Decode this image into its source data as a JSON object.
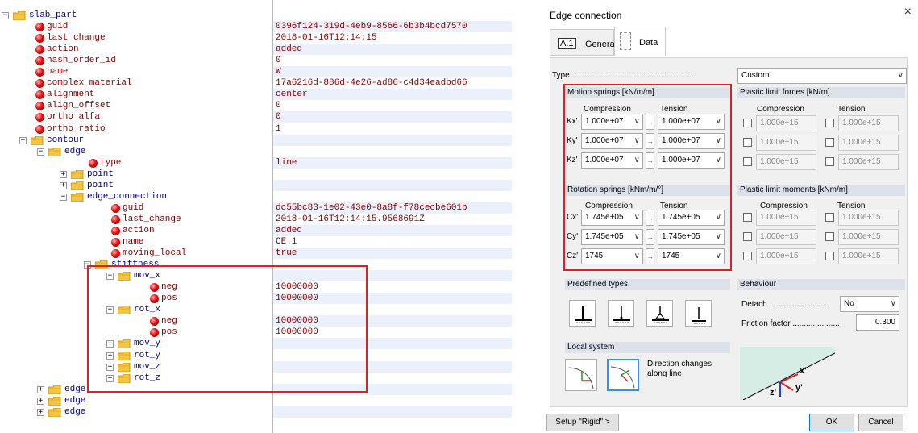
{
  "tree": {
    "rows": [
      {
        "label": "slab_part",
        "value": "",
        "kind": "folder",
        "level": 0
      },
      {
        "label": "guid",
        "value": "0396f124-319d-4eb9-8566-6b3b4bcd7570",
        "kind": "attr",
        "level": 1
      },
      {
        "label": "last_change",
        "value": "2018-01-16T12:14:15",
        "kind": "attr",
        "level": 1
      },
      {
        "label": "action",
        "value": "added",
        "kind": "attr",
        "level": 1
      },
      {
        "label": "hash_order_id",
        "value": "0",
        "kind": "attr",
        "level": 1
      },
      {
        "label": "name",
        "value": "W",
        "kind": "attr",
        "level": 1
      },
      {
        "label": "complex_material",
        "value": "17a6216d-886d-4e26-ad86-c4d34eadbd66",
        "kind": "attr",
        "level": 1
      },
      {
        "label": "alignment",
        "value": "center",
        "kind": "attr",
        "level": 1
      },
      {
        "label": "align_offset",
        "value": "0",
        "kind": "attr",
        "level": 1
      },
      {
        "label": "ortho_alfa",
        "value": "0",
        "kind": "attr",
        "level": 1
      },
      {
        "label": "ortho_ratio",
        "value": "1",
        "kind": "attr",
        "level": 1
      },
      {
        "label": "contour",
        "value": "",
        "kind": "folder",
        "level": 1
      },
      {
        "label": "edge",
        "value": "",
        "kind": "folder",
        "level": 2
      },
      {
        "label": "type",
        "value": "line",
        "kind": "attr",
        "level": 3
      },
      {
        "label": "point",
        "value": "",
        "kind": "folder",
        "level": 3
      },
      {
        "label": "point",
        "value": "",
        "kind": "folder",
        "level": 3
      },
      {
        "label": "edge_connection",
        "value": "",
        "kind": "folder",
        "level": 3
      },
      {
        "label": "guid",
        "value": "dc55bc83-1e02-43e0-8a8f-f78cecbe601b",
        "kind": "attr",
        "level": 4
      },
      {
        "label": "last_change",
        "value": "2018-01-16T12:14:15.9568691Z",
        "kind": "attr",
        "level": 4
      },
      {
        "label": "action",
        "value": "added",
        "kind": "attr",
        "level": 4
      },
      {
        "label": "name",
        "value": "CE.1",
        "kind": "attr",
        "level": 4
      },
      {
        "label": "moving_local",
        "value": "true",
        "kind": "attr",
        "level": 4
      },
      {
        "label": "stiffness",
        "value": "",
        "kind": "folder",
        "level": 4
      },
      {
        "label": "mov_x",
        "value": "",
        "kind": "folder",
        "level": 5
      },
      {
        "label": "neg",
        "value": "10000000",
        "kind": "attr",
        "level": 6
      },
      {
        "label": "pos",
        "value": "10000000",
        "kind": "attr",
        "level": 6
      },
      {
        "label": "rot_x",
        "value": "",
        "kind": "folder",
        "level": 5
      },
      {
        "label": "neg",
        "value": "10000000",
        "kind": "attr",
        "level": 6
      },
      {
        "label": "pos",
        "value": "10000000",
        "kind": "attr",
        "level": 6
      },
      {
        "label": "mov_y",
        "value": "",
        "kind": "folder",
        "level": 5
      },
      {
        "label": "rot_y",
        "value": "",
        "kind": "folder",
        "level": 5
      },
      {
        "label": "mov_z",
        "value": "",
        "kind": "folder",
        "level": 5
      },
      {
        "label": "rot_z",
        "value": "",
        "kind": "folder",
        "level": 5
      },
      {
        "label": "edge",
        "value": "",
        "kind": "folder",
        "level": 2
      },
      {
        "label": "edge",
        "value": "",
        "kind": "folder",
        "level": 2
      },
      {
        "label": "edge",
        "value": "",
        "kind": "folder",
        "level": 2
      }
    ]
  },
  "dialog": {
    "title": "Edge connection",
    "close": "×",
    "tabs": {
      "general_icon": "A.1",
      "general": "General",
      "data": "Data"
    },
    "type_label": "Type .......................................................",
    "type_value": "Custom",
    "motion_springs": {
      "title": "Motion springs [kN/m/m]",
      "compression": "Compression",
      "tension": "Tension",
      "rows": [
        {
          "label": "Kx'",
          "comp": "1.000e+07",
          "tens": "1.000e+07"
        },
        {
          "label": "Ky'",
          "comp": "1.000e+07",
          "tens": "1.000e+07"
        },
        {
          "label": "Kz'",
          "comp": "1.000e+07",
          "tens": "1.000e+07"
        }
      ]
    },
    "rotation_springs": {
      "title": "Rotation springs [kNm/m/°]",
      "compression": "Compression",
      "tension": "Tension",
      "rows": [
        {
          "label": "Cx'",
          "comp": "1.745e+05",
          "tens": "1.745e+05"
        },
        {
          "label": "Cy'",
          "comp": "1.745e+05",
          "tens": "1.745e+05"
        },
        {
          "label": "Cz'",
          "comp": "1745",
          "tens": "1745"
        }
      ]
    },
    "plastic_forces": {
      "title": "Plastic limit forces [kN/m]",
      "compression": "Compression",
      "tension": "Tension",
      "values": [
        "1.000e+15",
        "1.000e+15",
        "1.000e+15",
        "1.000e+15",
        "1.000e+15",
        "1.000e+15"
      ]
    },
    "plastic_moments": {
      "title": "Plastic limit moments [kNm/m]",
      "compression": "Compression",
      "tension": "Tension",
      "values": [
        "1.000e+15",
        "1.000e+15",
        "1.000e+15",
        "1.000e+15",
        "1.000e+15",
        "1.000e+15"
      ]
    },
    "predefined_title": "Predefined types",
    "behaviour": {
      "title": "Behaviour",
      "detach_label": "Detach ..........................",
      "detach_value": "No",
      "friction_label": "Friction factor .....................",
      "friction_value": "0.300"
    },
    "local_system": {
      "title": "Local system",
      "direction_text1": "Direction changes",
      "direction_text2": "along line"
    },
    "axes": {
      "x": "x'",
      "y": "y'",
      "z": "z'"
    },
    "buttons": {
      "setup": "Setup \"Rigid\" >",
      "ok": "OK",
      "cancel": "Cancel"
    },
    "arrow": "→",
    "dropdown": "∨"
  }
}
